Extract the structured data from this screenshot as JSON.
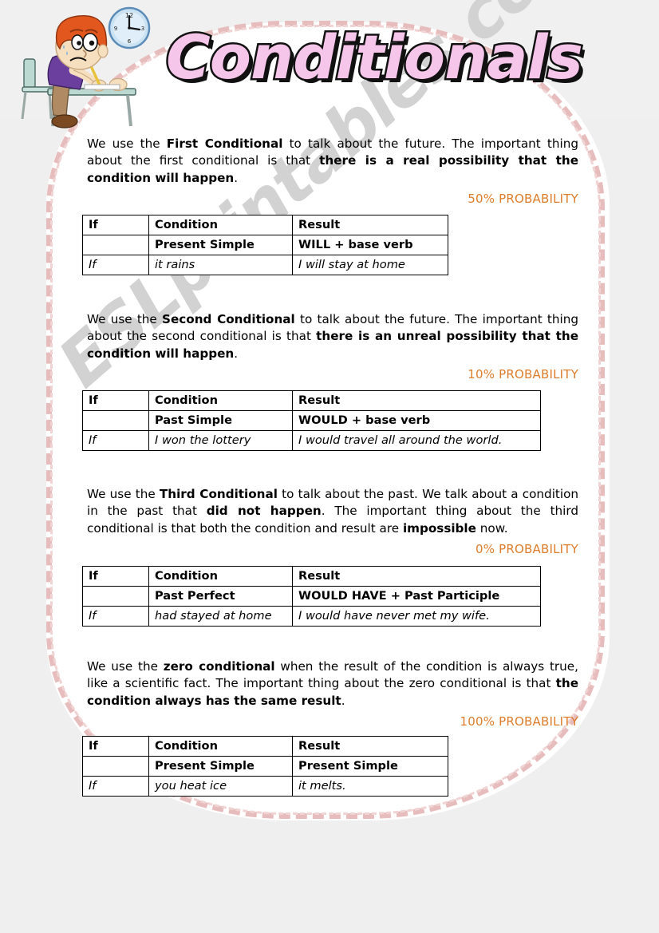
{
  "worksheet": {
    "title": "Conditionals",
    "watermark": "ESLprintables.com"
  },
  "colors": {
    "title_fill": "#F6C6EA",
    "title_outline": "#111111",
    "probability": "#DD7D2B",
    "frame_dash": "#E7BCBC",
    "page_background": "#EFEFEF",
    "sheet_background": "#FFFFFF"
  },
  "clipart": {
    "name": "boy-writing-at-desk-with-clock",
    "description": "Cartoon boy with orange hair and purple shirt writing at a desk, wall clock above",
    "hair_color": "#E2571E",
    "shirt_color": "#6B3F9E",
    "skin_color": "#F6DFBF",
    "desk_color": "#A8CCC4",
    "clock_face_color": "#CBE2F2",
    "pants_color": "#B08A63",
    "shoe_color": "#7B4A22"
  },
  "sections": [
    {
      "id": "first-conditional",
      "paragraph": [
        {
          "text": "We use the ",
          "bold": false
        },
        {
          "text": "First Conditional",
          "bold": true
        },
        {
          "text": " to talk about the future. The important thing about the first conditional is that ",
          "bold": false
        },
        {
          "text": "there is a real possibility that the condition will happen",
          "bold": true
        },
        {
          "text": ".",
          "bold": false
        }
      ],
      "probability": "50% PROBABILITY",
      "table": {
        "header": [
          "If",
          "Condition",
          "Result"
        ],
        "form": [
          "",
          "Present Simple",
          "WILL + base verb"
        ],
        "example": [
          "If",
          "it rains",
          "I will stay at home"
        ],
        "result_col_width": 180
      }
    },
    {
      "id": "second-conditional",
      "paragraph": [
        {
          "text": "We use the ",
          "bold": false
        },
        {
          "text": "Second Conditional",
          "bold": true
        },
        {
          "text": " to talk about the future. The important thing about the second conditional is that ",
          "bold": false
        },
        {
          "text": "there is an unreal possibility that the condition will happen",
          "bold": true
        },
        {
          "text": ".",
          "bold": false
        }
      ],
      "probability": "10% PROBABILITY",
      "table": {
        "header": [
          "If",
          "Condition",
          "Result"
        ],
        "form": [
          "",
          "Past Simple",
          "WOULD + base verb"
        ],
        "example": [
          "If",
          "I won the lottery",
          "I would travel all around the world."
        ],
        "result_col_width": 296
      }
    },
    {
      "id": "third-conditional",
      "paragraph": [
        {
          "text": "We use the ",
          "bold": false
        },
        {
          "text": "Third Conditional",
          "bold": true
        },
        {
          "text": " to talk about the past. We talk about a condition in the past that ",
          "bold": false
        },
        {
          "text": "did not happen",
          "bold": true
        },
        {
          "text": ". The important thing about the third conditional is that both the condition and result are ",
          "bold": false
        },
        {
          "text": "impossible",
          "bold": true
        },
        {
          "text": " now.",
          "bold": false
        }
      ],
      "probability": "0% PROBABILITY",
      "table": {
        "header": [
          "If",
          "Condition",
          "Result"
        ],
        "form": [
          "",
          "Past Perfect",
          "WOULD HAVE + Past Participle"
        ],
        "example": [
          "If",
          "had stayed at home",
          "I would have never met my wife."
        ],
        "result_col_width": 296
      }
    },
    {
      "id": "zero-conditional",
      "paragraph": [
        {
          "text": "We use the ",
          "bold": false
        },
        {
          "text": "zero conditional",
          "bold": true
        },
        {
          "text": " when the result of the condition is always true, like a scientific fact. The important thing about the zero conditional is that ",
          "bold": false
        },
        {
          "text": "the condition always has the same result",
          "bold": true
        },
        {
          "text": ".",
          "bold": false
        }
      ],
      "probability": "100% PROBABILITY",
      "table": {
        "header": [
          "If",
          "Condition",
          "Result"
        ],
        "form": [
          "",
          "Present Simple",
          "Present Simple"
        ],
        "example": [
          "If",
          "you heat ice",
          "it melts."
        ],
        "result_col_width": 180
      }
    }
  ]
}
